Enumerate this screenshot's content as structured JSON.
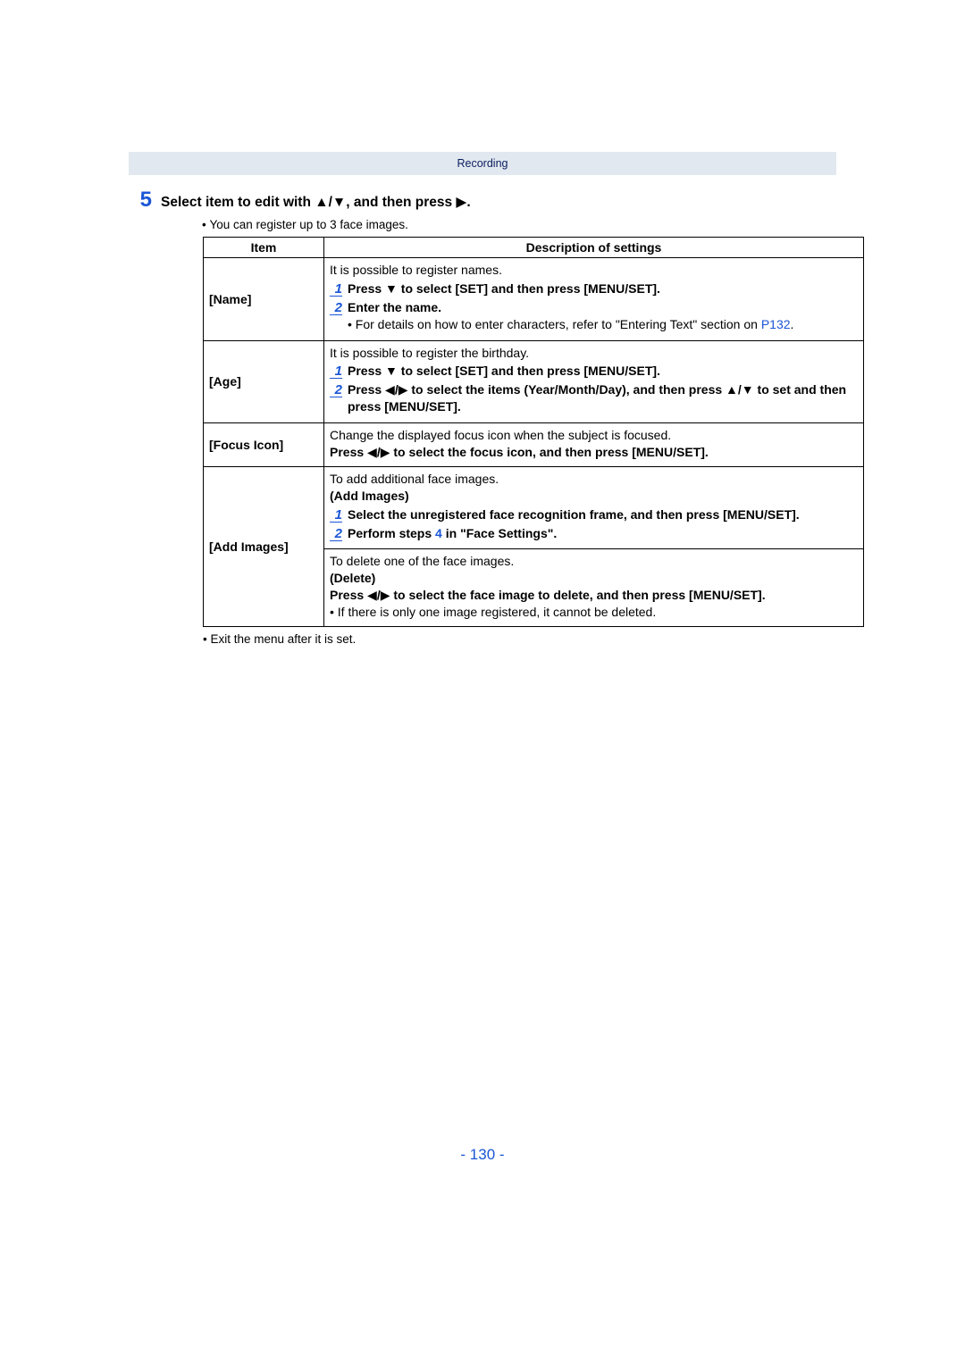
{
  "header": {
    "breadcrumb": "Recording"
  },
  "step5": {
    "number": "5",
    "text_a": "Select item to edit with ",
    "text_b": ", and then press ",
    "text_c": ".",
    "note": "You can register up to 3 face images."
  },
  "table": {
    "head_item": "Item",
    "head_desc": "Description of settings",
    "name_label": "[Name]",
    "name_intro": "It is possible to register names.",
    "name_s1_a": "Press ",
    "name_s1_b": " to select [SET] and then press [MENU/SET].",
    "name_s2": "Enter the name.",
    "name_detail_a": "For details on how to enter characters, refer to \"Entering Text\" section on ",
    "name_detail_link": "P132",
    "name_detail_c": ".",
    "age_label": "[Age]",
    "age_intro": "It is possible to register the birthday.",
    "age_s1_a": "Press ",
    "age_s1_b": " to select [SET] and then press [MENU/SET].",
    "age_s2_a": "Press ",
    "age_s2_b": " to select the items (Year/Month/Day), and then press ",
    "age_s2_c": " to set and then press [MENU/SET].",
    "focus_label": "[Focus Icon]",
    "focus_line1": "Change the displayed focus icon when the subject is focused.",
    "focus_line2_a": "Press ",
    "focus_line2_b": " to select the focus icon, and then press [MENU/SET].",
    "addimg_label": "[Add Images]",
    "addimg_intro": "To add additional face images.",
    "addimg_sub": "(Add Images)",
    "addimg_s1": "Select the unregistered face recognition frame, and then press [MENU/SET].",
    "addimg_s2_a": "Perform steps ",
    "addimg_s2_ref": "4",
    "addimg_s2_b": " in \"Face Settings\".",
    "delimg_intro": "To delete one of the face images.",
    "delimg_sub": "(Delete)",
    "delimg_line_a": "Press ",
    "delimg_line_b": " to select the face image to delete, and then press [MENU/SET].",
    "delimg_note": "If there is only one image registered, it cannot be deleted."
  },
  "after_note": "Exit the menu after it is set.",
  "page_number": "- 130 -",
  "nums": {
    "one": "1",
    "two": "2"
  }
}
